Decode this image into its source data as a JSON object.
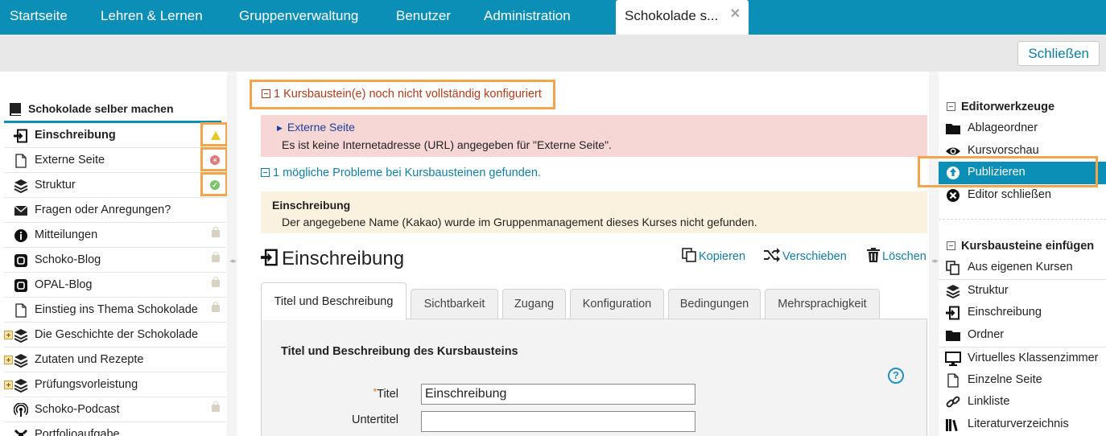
{
  "topnav": {
    "tabs": [
      {
        "label": "Startseite"
      },
      {
        "label": "Lehren & Lernen"
      },
      {
        "label": "Gruppenverwaltung"
      },
      {
        "label": "Benutzer"
      },
      {
        "label": "Administration"
      },
      {
        "label": "Schokolade s..."
      }
    ],
    "close_glyph": "✕"
  },
  "toolbar": {
    "close_label": "Schließen"
  },
  "course": {
    "title": "Schokolade selber machen",
    "nodes": [
      {
        "label": "Einschreibung",
        "icon": "enrollment-icon",
        "status": "warning"
      },
      {
        "label": "Externe Seite",
        "icon": "page-icon",
        "status": "error"
      },
      {
        "label": "Struktur",
        "icon": "layers-icon",
        "status": "ok"
      },
      {
        "label": "Fragen oder Anregungen?",
        "icon": "mail-icon"
      },
      {
        "label": "Mitteilungen",
        "icon": "info-icon",
        "locked": true
      },
      {
        "label": "Schoko-Blog",
        "icon": "blog-icon",
        "locked": true
      },
      {
        "label": "OPAL-Blog",
        "icon": "blog-icon",
        "locked": true
      },
      {
        "label": "Einstieg ins Thema Schokolade",
        "icon": "page-icon",
        "locked": true
      },
      {
        "label": "Die Geschichte der Schokolade",
        "icon": "layers-icon",
        "expandable": true
      },
      {
        "label": "Zutaten und Rezepte",
        "icon": "layers-icon",
        "expandable": true
      },
      {
        "label": "Prüfungsvorleistung",
        "icon": "layers-icon",
        "expandable": true
      },
      {
        "label": "Schoko-Podcast",
        "icon": "podcast-icon",
        "locked": true
      },
      {
        "label": "Portfolioaufgabe",
        "icon": "portfolio-icon"
      }
    ]
  },
  "messages": {
    "warning_header": "1 Kursbaustein(e) noch nicht vollständig konfiguriert",
    "error_node": "Externe Seite",
    "error_text": "Es ist keine Internetadresse (URL) angegeben für \"Externe Seite\".",
    "info_header": "1 mögliche Probleme bei Kursbausteinen gefunden.",
    "hint_node": "Einschreibung",
    "hint_text": "Der angegebene Name (Kakao) wurde im Gruppenmanagement dieses Kurses nicht gefunden."
  },
  "editor": {
    "node_title": "Einschreibung",
    "actions": {
      "copy": "Kopieren",
      "move": "Verschieben",
      "delete": "Löschen"
    },
    "tabs": [
      {
        "label": "Titel und Beschreibung"
      },
      {
        "label": "Sichtbarkeit"
      },
      {
        "label": "Zugang"
      },
      {
        "label": "Konfiguration"
      },
      {
        "label": "Bedingungen"
      },
      {
        "label": "Mehrsprachigkeit"
      }
    ],
    "form": {
      "heading": "Titel und Beschreibung des Kursbausteins",
      "help_glyph": "?",
      "title_label": "Titel",
      "required_mark": "*",
      "title_value": "Einschreibung",
      "subtitle_label": "Untertitel",
      "subtitle_value": ""
    }
  },
  "tools": {
    "group_label": "Editorwerkzeuge",
    "items": [
      {
        "label": "Ablageordner"
      },
      {
        "label": "Kursvorschau"
      },
      {
        "label": "Publizieren"
      },
      {
        "label": "Editor schließen"
      }
    ]
  },
  "insert": {
    "group_label": "Kursbausteine einfügen",
    "items": [
      {
        "label": "Aus eigenen Kursen"
      },
      {
        "label": "Struktur"
      },
      {
        "label": "Einschreibung"
      },
      {
        "label": "Ordner"
      },
      {
        "label": "Virtuelles Klassenzimmer"
      },
      {
        "label": "Einzelne Seite"
      },
      {
        "label": "Linkliste"
      },
      {
        "label": "Literaturverzeichnis"
      }
    ]
  },
  "colors": {
    "brand": "#0b8fb7",
    "highlight_frame": "#f2a54b",
    "error_bg": "#f7d6d6",
    "hint_bg": "#fbf1df",
    "link": "#117ea7"
  }
}
